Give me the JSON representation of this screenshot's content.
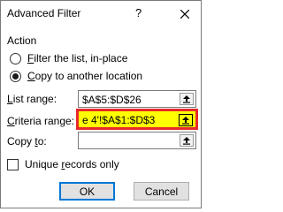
{
  "title": "Advanced Filter",
  "help_label": "?",
  "action_label": "Action",
  "radios": [
    {
      "pre": "",
      "mnemonic": "F",
      "post": "ilter the list, in-place",
      "checked": false
    },
    {
      "pre": "",
      "mnemonic": "C",
      "post": "opy to another location",
      "checked": true
    }
  ],
  "list_range": {
    "pre": "",
    "mnemonic": "L",
    "post": "ist range:",
    "value": "$A$5:$D$26"
  },
  "criteria_range": {
    "pre": "",
    "mnemonic": "C",
    "post": "riteria range:",
    "value": "e 4'!$A$1:$D$3"
  },
  "copy_to": {
    "pre": "Copy ",
    "mnemonic": "t",
    "post": "o:",
    "value": ""
  },
  "unique": {
    "pre": "Unique ",
    "mnemonic": "r",
    "post": "ecords only",
    "checked": false
  },
  "ok_label": "OK",
  "cancel_label": "Cancel",
  "colors": {
    "highlight_fill": "#ffff00",
    "highlight_border": "#e82a2a",
    "default_button_border": "#0078d7"
  }
}
